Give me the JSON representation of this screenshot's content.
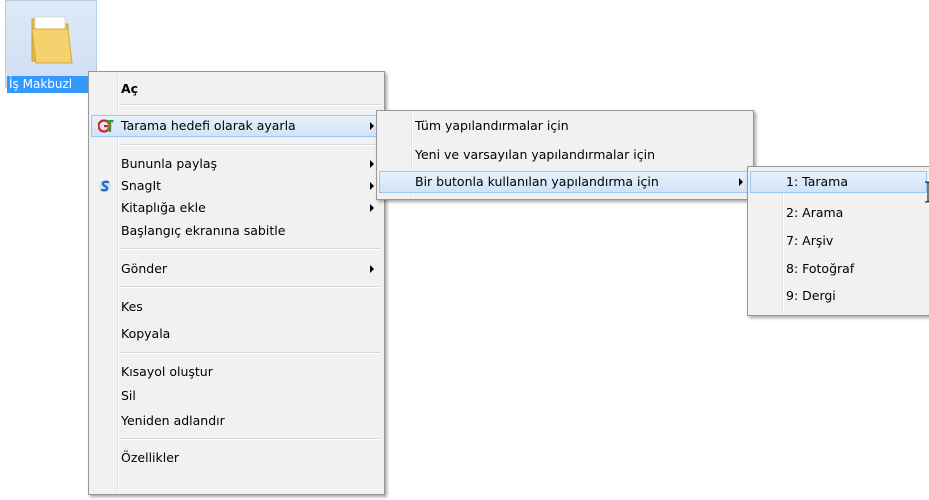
{
  "desktop_icon": {
    "label": "İş Makbuzl"
  },
  "context_menu": {
    "items": [
      {
        "label": "Aç"
      },
      {
        "label": "Tarama hedefi olarak ayarla"
      },
      {
        "label": "Bununla paylaş"
      },
      {
        "label": "SnagIt"
      },
      {
        "label": "Kitaplığa ekle"
      },
      {
        "label": "Başlangıç ekranına sabitle"
      },
      {
        "label": "Gönder"
      },
      {
        "label": "Kes"
      },
      {
        "label": "Kopyala"
      },
      {
        "label": "Kısayol oluştur"
      },
      {
        "label": "Sil"
      },
      {
        "label": "Yeniden adlandır"
      },
      {
        "label": "Özellikler"
      }
    ]
  },
  "submenu1": {
    "items": [
      {
        "label": "Tüm yapılandırmalar için"
      },
      {
        "label": "Yeni ve varsayılan yapılandırmalar için"
      },
      {
        "label": "Bir butonla kullanılan yapılandırma için"
      }
    ]
  },
  "submenu2": {
    "items": [
      {
        "label": "1: Tarama"
      },
      {
        "label": "2: Arama"
      },
      {
        "label": "7: Arşiv"
      },
      {
        "label": "8: Fotoğraf"
      },
      {
        "label": "9: Dergi"
      }
    ]
  },
  "colors": {
    "highlight_border": "#99c6f2",
    "menu_bg": "#f1f1f1",
    "selection_blue": "#3399ff"
  }
}
